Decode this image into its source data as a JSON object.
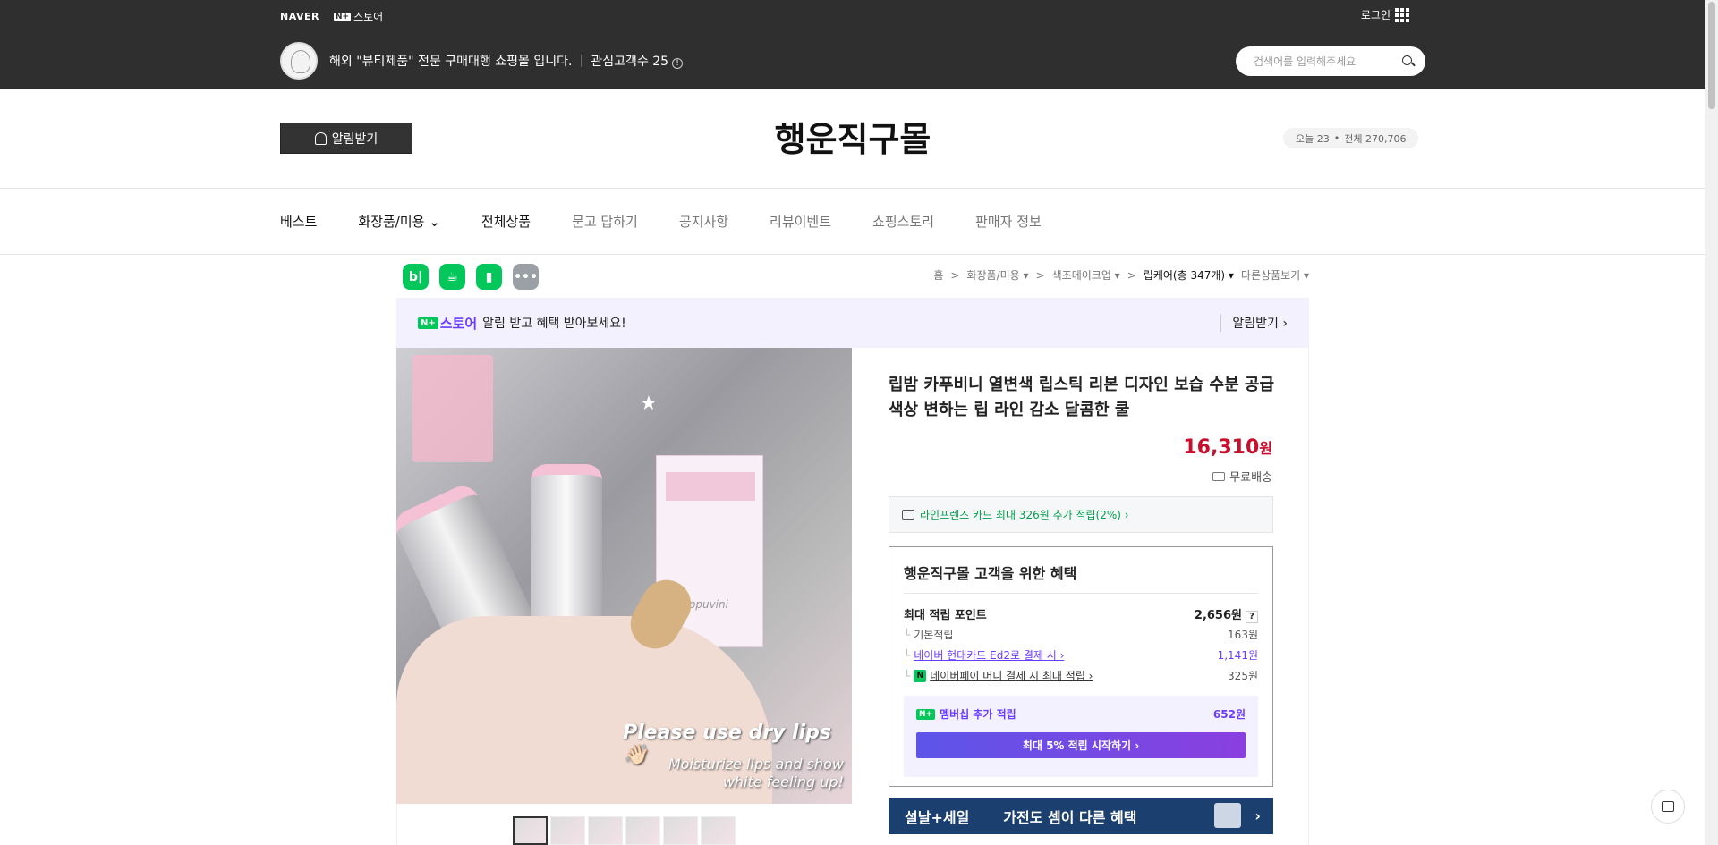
{
  "topbar": {
    "naver": "NAVER",
    "nplus_badge": "N+",
    "store_label": "스토어",
    "login": "로그인",
    "seller_description": "해외 \"뷰티제품\" 전문 구매대행 쇼핑몰 입니다.",
    "followers_label": "관심고객수 25",
    "search_placeholder": "검색어를 입력해주세요"
  },
  "store": {
    "notify_button": "알림받기",
    "title": "행운직구몰",
    "visitors_today": "오늘 23",
    "visitors_dot": "•",
    "visitors_total": "전체 270,706"
  },
  "nav": {
    "items": [
      "베스트",
      "화장품/미용",
      "전체상품",
      "묻고 답하기",
      "공지사항",
      "리뷰이벤트",
      "쇼핑스토리",
      "판매자 정보"
    ]
  },
  "share": {
    "icons": [
      "blog",
      "cafe",
      "talk",
      "more"
    ]
  },
  "breadcrumb": {
    "home": "홈",
    "cat1": "화장품/미용 ▾",
    "cat2": "색조메이크업 ▾",
    "cat3": "립케어(총 347개) ▾",
    "other": "다른상품보기 ▾",
    "sep": ">"
  },
  "promo": {
    "brand": "스토어",
    "badge": "N+",
    "text": "알림 받고 혜택 받아보세요!",
    "action": "알림받기 ›"
  },
  "product": {
    "image_text1": "Please use dry lips👋🏻",
    "image_text2": "Moisturize lips and show white feeling up!",
    "box_brand": "Cappuvini",
    "title": "립밤 카푸비니 열변색 립스틱 리본 디자인 보습 수분 공급 색상 변하는 립 라인 감소 달콤한 쿨",
    "price": "16,310",
    "currency": "원",
    "delivery": "무료배송",
    "thumbnail_count": 6
  },
  "card_benefit": {
    "text": "라인프렌즈 카드 최대 326원 추가 적립(2%) ›"
  },
  "benefits": {
    "title": "행운직구몰 고객을 위한 혜택",
    "max_points_label": "최대 적립 포인트",
    "max_points_value": "2,656원",
    "q": "?",
    "rows": [
      {
        "label": "기본적립",
        "value": "163원"
      },
      {
        "label": "네이버 현대카드 Ed2로 결제 시 ›",
        "value": "1,141원"
      },
      {
        "label": "네이버페이 머니 결제 시 최대 적립 ›",
        "value": "325원"
      }
    ],
    "membership_badge": "N+",
    "membership_label": "멤버십 추가 적립",
    "membership_value": "652원",
    "start_button": "최대 5% 적립 시작하기 ›"
  },
  "banner": {
    "label": "설날+세일",
    "text": "가전도 셈이 다른 혜택",
    "arrow": "›"
  }
}
